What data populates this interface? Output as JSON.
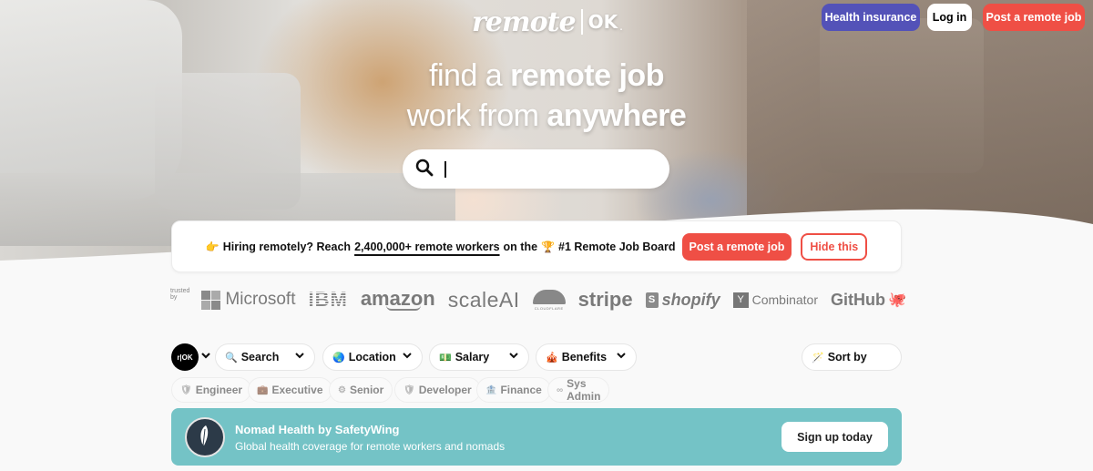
{
  "header": {
    "logo_main": "remote",
    "logo_suffix": "OK",
    "logo_dot": ".",
    "buttons": {
      "health_insurance": "Health insurance",
      "login": "Log in",
      "post_job": "Post a remote job"
    }
  },
  "hero": {
    "line1_prefix": "find a ",
    "line1_bold": "remote job",
    "line2_prefix": "work from ",
    "line2_bold": "anywhere",
    "search": {
      "value": "",
      "placeholder": ""
    }
  },
  "hiring_banner": {
    "emoji_pointer": "👉",
    "text_prefix": "Hiring remotely? Reach",
    "link_text": "2,400,000+ remote workers",
    "text_middle": "on the",
    "emoji_trophy": "🏆",
    "text_suffix": "#1 Remote Job Board",
    "post_button": "Post a remote job",
    "hide_button": "Hide this"
  },
  "trusted": {
    "label": "trusted by",
    "brands": [
      "Microsoft",
      "IBM",
      "amazon",
      "scaleAI",
      "CLOUDFLARE",
      "stripe",
      "shopify",
      "Combinator",
      "GitHub"
    ],
    "yc_letter": "Y",
    "shopify_letter": "S"
  },
  "filters": {
    "ok_logo": "r|OK",
    "items": [
      {
        "icon": "🔍",
        "label": "Search"
      },
      {
        "icon": "🌏",
        "label": "Location"
      },
      {
        "icon": "💵",
        "label": "Salary"
      },
      {
        "icon": "🎪",
        "label": "Benefits"
      }
    ],
    "sort": {
      "icon": "🪄",
      "label": "Sort by"
    }
  },
  "tags": [
    {
      "icon": "🛡",
      "label": "Engineer"
    },
    {
      "icon": "💼",
      "label": "Executive"
    },
    {
      "icon": "⚙",
      "label": "Senior"
    },
    {
      "icon": "🛡",
      "label": "Developer"
    },
    {
      "icon": "🏦",
      "label": "Finance"
    },
    {
      "icon": "∞",
      "label": "Sys Admin"
    }
  ],
  "nomad_banner": {
    "title": "Nomad Health by SafetyWing",
    "subtitle": "Global health coverage for remote workers and nomads",
    "cta": "Sign up today"
  },
  "colors": {
    "brand_red": "#ef4f45",
    "health_purple": "#5352b8",
    "nomad_teal": "#74c3c6"
  }
}
